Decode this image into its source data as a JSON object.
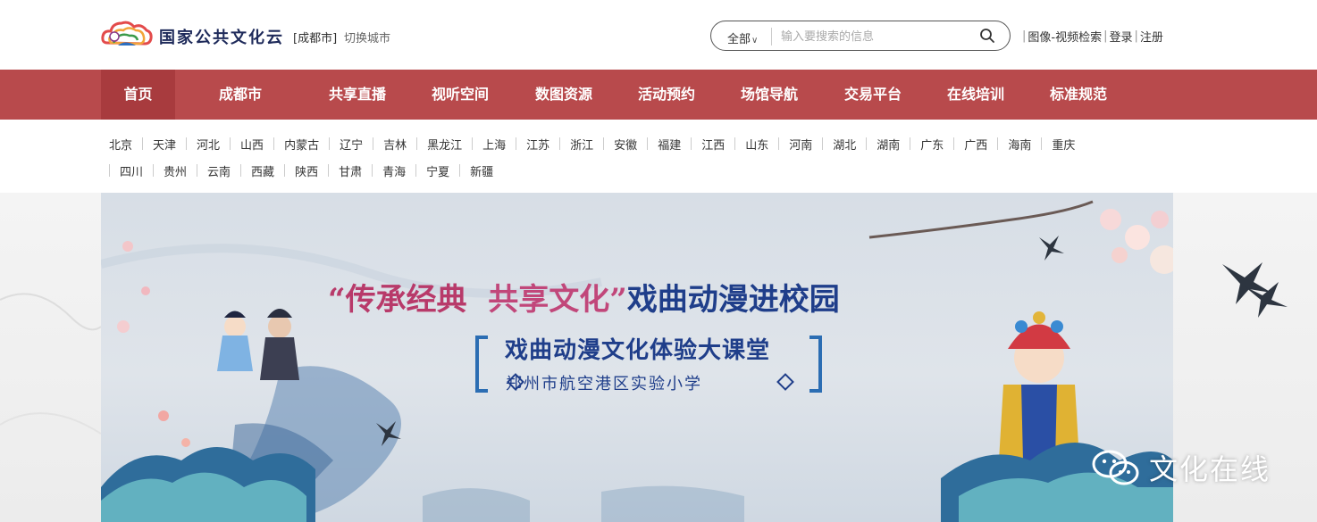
{
  "header": {
    "logo_text": "国家公共文化云",
    "city_current": "[成都市]",
    "city_switch": "切换城市"
  },
  "search": {
    "scope": "全部",
    "placeholder": "输入要搜索的信息"
  },
  "toplinks": {
    "image_video_search": "图像-视频检索",
    "login": "登录",
    "register": "注册"
  },
  "nav": {
    "items": [
      {
        "label": "首页",
        "active": true
      },
      {
        "label": "成都市"
      },
      {
        "label": "共享直播"
      },
      {
        "label": "视听空间"
      },
      {
        "label": "数图资源"
      },
      {
        "label": "活动预约"
      },
      {
        "label": "场馆导航"
      },
      {
        "label": "交易平台"
      },
      {
        "label": "在线培训"
      },
      {
        "label": "标准规范"
      }
    ]
  },
  "provinces": {
    "row1": [
      "北京",
      "天津",
      "河北",
      "山西",
      "内蒙古",
      "辽宁",
      "吉林",
      "黑龙江",
      "上海",
      "江苏",
      "浙江",
      "安徽",
      "福建",
      "江西",
      "山东",
      "河南",
      "湖北",
      "湖南",
      "广东",
      "广西",
      "海南",
      "重庆"
    ],
    "row2": [
      "四川",
      "贵州",
      "云南",
      "西藏",
      "陕西",
      "甘肃",
      "青海",
      "宁夏",
      "新疆"
    ]
  },
  "banner": {
    "title_open_quote": "“",
    "title_part1": "传承经典",
    "title_part2": "共享文化",
    "title_close_quote": "”",
    "title_part3": "戏曲动漫进校园",
    "subtitle": "戏曲动漫文化体验大课堂",
    "school": "郑州市航空港区实验小学"
  },
  "watermark": {
    "text": "文化在线"
  },
  "colors": {
    "nav_bg": "#b84a4c",
    "nav_active": "#a83b3e",
    "banner_text": "#1f3e8a",
    "bracket": "#2b6db3"
  }
}
